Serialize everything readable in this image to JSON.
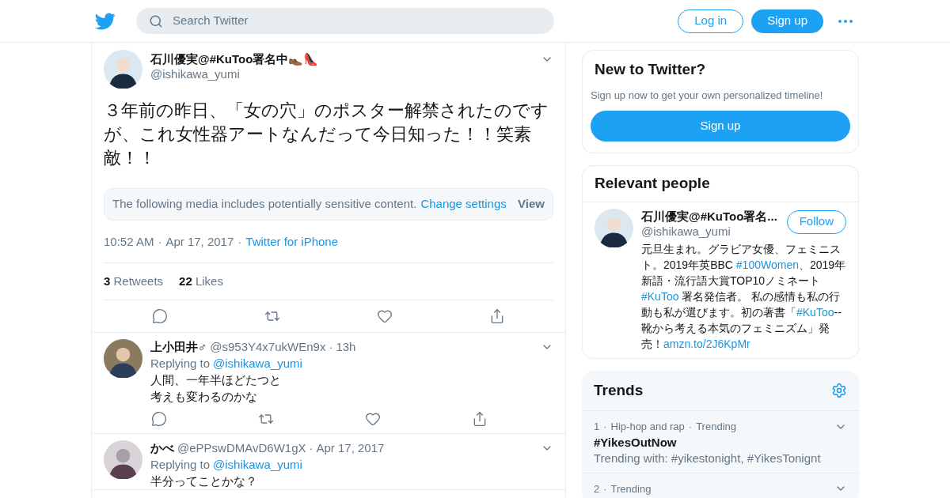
{
  "header": {
    "search": {
      "placeholder": "Search Twitter"
    },
    "login": "Log in",
    "signup": "Sign up"
  },
  "tweet": {
    "name": "石川優実@#KuToo署名中👞👠",
    "handle": "@ishikawa_yumi",
    "text": "３年前の昨日、「女の穴」のポスター解禁されたのですが、これ女性器アートなんだって今日知った！！笑素敵！！",
    "sensitive": {
      "message": "The following media includes potentially sensitive content.",
      "link": "Change settings",
      "view": "View"
    },
    "separator": "·",
    "time": "10:52 AM",
    "date": "Apr 17, 2017",
    "source": "Twitter for iPhone",
    "stats": [
      {
        "count": "3",
        "label": "Retweets"
      },
      {
        "count": "22",
        "label": "Likes"
      }
    ]
  },
  "replies": [
    {
      "name": "上小田井♂",
      "handle": "@s953Y4x7ukWEn9x",
      "separator": "·",
      "time": "13h",
      "replying_label": "Replying to",
      "replying_to": "@ishikawa_yumi",
      "lines": [
        "人間、一年半ほどたつと",
        "考えも変わるのかな"
      ]
    },
    {
      "name": "かべ",
      "handle": "@ePPswDMAvD6W1gX",
      "separator": "·",
      "time": "Apr 17, 2017",
      "replying_label": "Replying to",
      "replying_to": "@ishikawa_yumi",
      "lines": [
        "半分ってことかな？"
      ]
    }
  ],
  "new_to_twitter": {
    "title": "New to Twitter?",
    "text": "Sign up now to get your own personalized timeline!",
    "button": "Sign up"
  },
  "relevant_people": {
    "title": "Relevant people",
    "person": {
      "name": "石川優実@#KuToo署名...",
      "handle": "@ishikawa_yumi",
      "follow": "Follow",
      "bio": [
        {
          "text": "元旦生まれ。グラビア女優、フェミニスト。2019年英BBC ",
          "link": false
        },
        {
          "text": "#100Women",
          "link": true
        },
        {
          "text": "、2019年新語・流行語大賞TOP10ノミネート ",
          "link": false
        },
        {
          "text": "#KuToo",
          "link": true
        },
        {
          "text": " 署名発信者。 私の感情も私の行動も私が選びます。初の著書「",
          "link": false
        },
        {
          "text": "#KuToo",
          "link": true
        },
        {
          "text": "--靴から考える本気のフェミニズム」発売！",
          "link": false
        },
        {
          "text": "amzn.to/2J6KpMr",
          "link": true
        }
      ]
    }
  },
  "trends": {
    "title": "Trends",
    "items": [
      {
        "rank": "1",
        "separator": "·",
        "context": [
          "Hip-hop and rap",
          "Trending"
        ],
        "name": "#YikesOutNow",
        "detail": "Trending with: #yikestonight, #YikesTonignt"
      },
      {
        "rank": "2",
        "separator": "·",
        "context": [
          "Trending"
        ]
      }
    ]
  }
}
